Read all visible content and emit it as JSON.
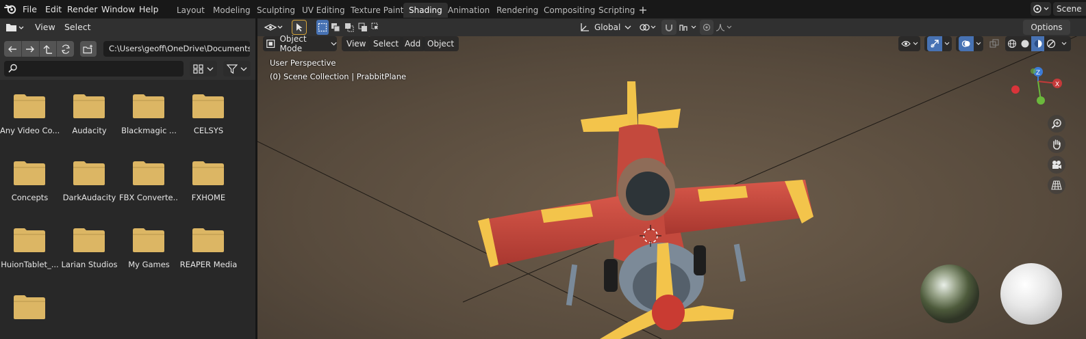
{
  "topbar": {
    "menu": [
      "File",
      "Edit",
      "Render",
      "Window",
      "Help"
    ],
    "workspaces": [
      "Layout",
      "Modeling",
      "Sculpting",
      "UV Editing",
      "Texture Paint",
      "Shading",
      "Animation",
      "Rendering",
      "Compositing",
      "Scripting"
    ],
    "active_workspace": "Shading",
    "add_workspace_symbol": "+",
    "scene_label": "Scene"
  },
  "file_browser": {
    "header_menu": [
      "View",
      "Select"
    ],
    "path": "C:\\Users\\geoff\\OneDrive\\Documents\\",
    "search_placeholder": "",
    "folders": [
      "Any Video Co...",
      "Audacity",
      "Blackmagic ...",
      "CELSYS",
      "Concepts",
      "DarkAudacity",
      "FBX Converte...",
      "FXHOME",
      "HuionTablet_...",
      "Larian Studios",
      "My Games",
      "REAPER Media",
      ""
    ],
    "folder_color": "#dcb664"
  },
  "viewport": {
    "transform_orientation": "Global",
    "options_label": "Options",
    "mode": "Object Mode",
    "menus": [
      "View",
      "Select",
      "Add",
      "Object"
    ],
    "perspective_label": "User Perspective",
    "collection_label": "(0) Scene Collection | PrabbitPlane",
    "gizmo_axes": {
      "z": "Z",
      "x": "X"
    },
    "accent_color": "#4772b3",
    "shading_mode": "material-preview"
  }
}
